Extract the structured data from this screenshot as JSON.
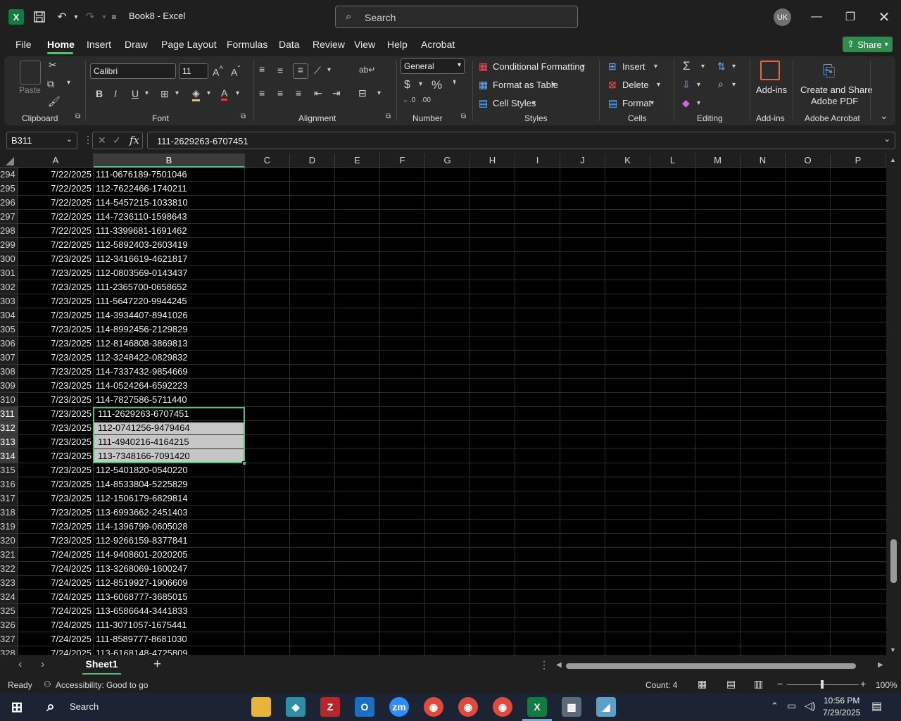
{
  "titlebar": {
    "doc_title": "Book8  -  Excel",
    "search_placeholder": "Search",
    "avatar_initials": "UK"
  },
  "menu": {
    "tabs": [
      "File",
      "Home",
      "Insert",
      "Draw",
      "Page Layout",
      "Formulas",
      "Data",
      "Review",
      "View",
      "Help",
      "Acrobat"
    ],
    "share_label": "Share"
  },
  "ribbon": {
    "groups": [
      "Clipboard",
      "Font",
      "Alignment",
      "Number",
      "Styles",
      "Cells",
      "Editing",
      "Add-ins",
      "Adobe Acrobat"
    ],
    "paste_label": "Paste",
    "font_name": "Calibri",
    "font_size": "11",
    "number_format": "General",
    "conditional_formatting": "Conditional Formatting",
    "format_as_table": "Format as Table",
    "cell_styles": "Cell Styles",
    "insert": "Insert",
    "delete": "Delete",
    "format": "Format",
    "addins_label": "Add-ins",
    "create_share_pdf_1": "Create and Share",
    "create_share_pdf_2": "Adobe PDF",
    "accent_color": "#4fbf7c"
  },
  "formula_bar": {
    "name_box": "B311",
    "value": "111-2629263-6707451",
    "fx": "fx"
  },
  "columns": [
    "A",
    "B",
    "C",
    "D",
    "E",
    "F",
    "G",
    "H",
    "I",
    "J",
    "K",
    "L",
    "M",
    "N",
    "O",
    "P"
  ],
  "rows": [
    {
      "n": "294",
      "a": "7/22/2025",
      "b": "111-0676189-7501046"
    },
    {
      "n": "295",
      "a": "7/22/2025",
      "b": "112-7622466-1740211"
    },
    {
      "n": "296",
      "a": "7/22/2025",
      "b": "114-5457215-1033810"
    },
    {
      "n": "297",
      "a": "7/22/2025",
      "b": "114-7236110-1598643"
    },
    {
      "n": "298",
      "a": "7/22/2025",
      "b": "111-3399681-1691462"
    },
    {
      "n": "299",
      "a": "7/22/2025",
      "b": "112-5892403-2603419"
    },
    {
      "n": "300",
      "a": "7/23/2025",
      "b": "112-3416619-4621817"
    },
    {
      "n": "301",
      "a": "7/23/2025",
      "b": "112-0803569-0143437"
    },
    {
      "n": "302",
      "a": "7/23/2025",
      "b": "111-2365700-0658652"
    },
    {
      "n": "303",
      "a": "7/23/2025",
      "b": "111-5647220-9944245"
    },
    {
      "n": "304",
      "a": "7/23/2025",
      "b": "114-3934407-8941026"
    },
    {
      "n": "305",
      "a": "7/23/2025",
      "b": "114-8992456-2129829"
    },
    {
      "n": "306",
      "a": "7/23/2025",
      "b": "112-8146808-3869813"
    },
    {
      "n": "307",
      "a": "7/23/2025",
      "b": "112-3248422-0829832"
    },
    {
      "n": "308",
      "a": "7/23/2025",
      "b": "114-7337432-9854669"
    },
    {
      "n": "309",
      "a": "7/23/2025",
      "b": "114-0524264-6592223"
    },
    {
      "n": "310",
      "a": "7/23/2025",
      "b": "114-7827586-5711440"
    },
    {
      "n": "311",
      "a": "7/23/2025",
      "b": "111-2629263-6707451"
    },
    {
      "n": "312",
      "a": "7/23/2025",
      "b": "112-0741256-9479464"
    },
    {
      "n": "313",
      "a": "7/23/2025",
      "b": "111-4940216-4164215"
    },
    {
      "n": "314",
      "a": "7/23/2025",
      "b": "113-7348166-7091420"
    },
    {
      "n": "315",
      "a": "7/23/2025",
      "b": "112-5401820-0540220"
    },
    {
      "n": "316",
      "a": "7/23/2025",
      "b": "114-8533804-5225829"
    },
    {
      "n": "317",
      "a": "7/23/2025",
      "b": "112-1506179-6829814"
    },
    {
      "n": "318",
      "a": "7/23/2025",
      "b": "113-6993662-2451403"
    },
    {
      "n": "319",
      "a": "7/23/2025",
      "b": "114-1396799-0605028"
    },
    {
      "n": "320",
      "a": "7/23/2025",
      "b": "112-9266159-8377841"
    },
    {
      "n": "321",
      "a": "7/24/2025",
      "b": "114-9408601-2020205"
    },
    {
      "n": "322",
      "a": "7/24/2025",
      "b": "113-3268069-1600247"
    },
    {
      "n": "323",
      "a": "7/24/2025",
      "b": "112-8519927-1906609"
    },
    {
      "n": "324",
      "a": "7/24/2025",
      "b": "113-6068777-3685015"
    },
    {
      "n": "325",
      "a": "7/24/2025",
      "b": "113-6586644-3441833"
    },
    {
      "n": "326",
      "a": "7/24/2025",
      "b": "111-3071057-1675441"
    },
    {
      "n": "327",
      "a": "7/24/2025",
      "b": "111-8589777-8681030"
    },
    {
      "n": "328",
      "a": "7/24/2025",
      "b": "113-6168148-4725809"
    }
  ],
  "sheet": {
    "tab_name": "Sheet1"
  },
  "status": {
    "ready": "Ready",
    "accessibility": "Accessibility: Good to go",
    "count": "Count: 4",
    "zoom": "100%"
  },
  "taskbar": {
    "search_label": "Search",
    "time": "10:56 PM",
    "date": "7/29/2025"
  }
}
